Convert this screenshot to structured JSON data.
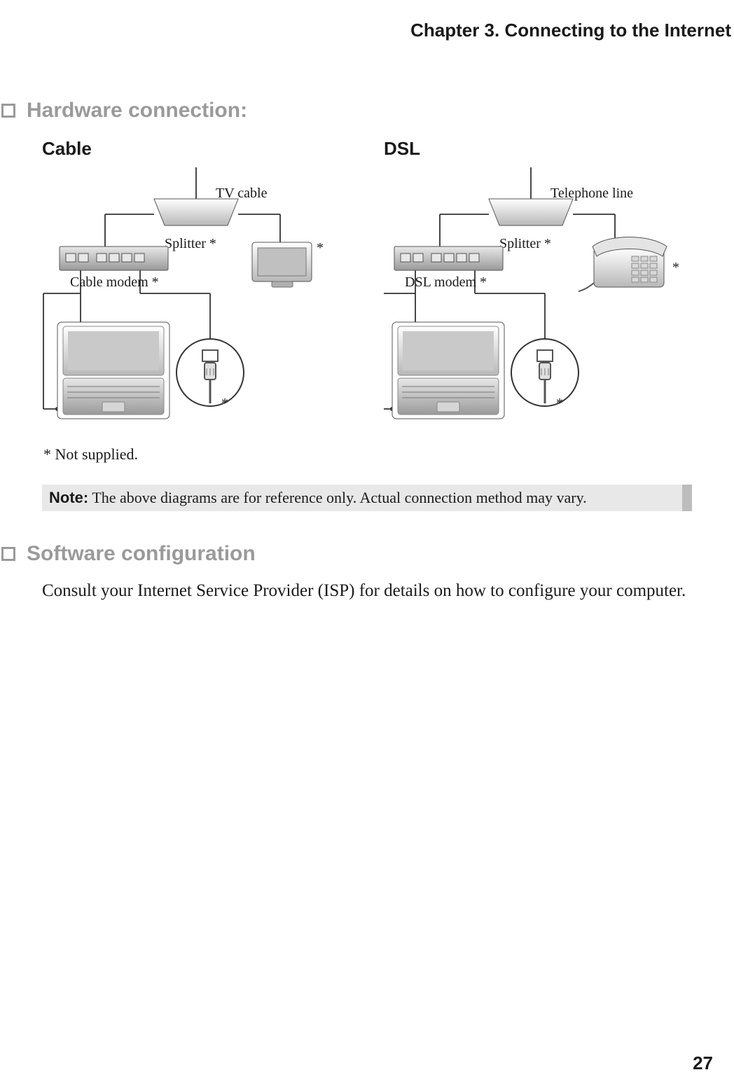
{
  "chapter": "Chapter 3. Connecting to the Internet",
  "section1": {
    "title": "Hardware connection:",
    "cable": {
      "heading": "Cable",
      "tv_cable": "TV cable",
      "splitter": "Splitter *",
      "cable_modem": "Cable modem *",
      "monitor_ast": "*",
      "plug_ast": "*"
    },
    "dsl": {
      "heading": "DSL",
      "tel_line": "Telephone line",
      "splitter": "Splitter *",
      "dsl_modem": "DSL modem *",
      "phone_ast": "*",
      "plug_ast": "*"
    },
    "not_supplied": "* Not supplied."
  },
  "note": {
    "label": "Note:",
    "text": "The above diagrams are for reference only. Actual connection method may vary."
  },
  "section2": {
    "title": "Software configuration",
    "body": "Consult your Internet Service Provider (ISP) for details on how to configure your computer."
  },
  "page_number": "27"
}
